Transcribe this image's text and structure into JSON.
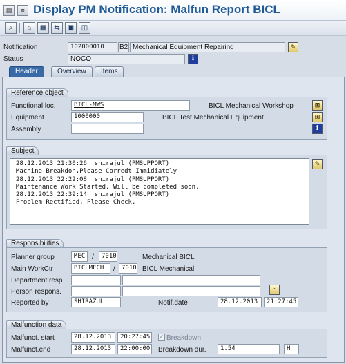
{
  "window": {
    "title": "Display PM Notification: Malfun Report BICL"
  },
  "header": {
    "notification_label": "Notification",
    "notification_number": "102000010",
    "notification_type": "B2",
    "notification_desc": "Mechanical Equipment Repairing",
    "status_label": "Status",
    "status_value": "NOCO"
  },
  "tabs": [
    {
      "label": "Header"
    },
    {
      "label": "Overview"
    },
    {
      "label": "Items"
    }
  ],
  "reference": {
    "title": "Reference object",
    "func_loc_label": "Functional loc.",
    "func_loc_value": "BICL-MWS",
    "func_loc_desc": "BICL Mechanical Workshop",
    "equipment_label": "Equipment",
    "equipment_value": "1000000",
    "equipment_desc": "BICL Test Mechanical Equipment",
    "assembly_label": "Assembly"
  },
  "subject": {
    "title": "Subject",
    "lines": [
      "28.12.2013 21:30:26  shirajul (PMSUPPORT)",
      "Machine Breakdon,Please Corredt Immidiately",
      "28.12.2013 22:22:08  shirajul (PMSUPPORT)",
      "Maintenance Work Started. Will be completed soon.",
      "28.12.2013 22:39:14  shirajul (PMSUPPORT)",
      "Problem Rectified, Please Check."
    ]
  },
  "responsibilities": {
    "title": "Responsibilities",
    "planner_label": "Planner group",
    "planner_code": "MEC",
    "planner_plant": "7010",
    "planner_desc": "Mechanical BICL",
    "workctr_label": "Main WorkCtr",
    "workctr_code": "BICLMECH",
    "workctr_plant": "7010",
    "workctr_desc": "BICL Mechanical",
    "dept_label": "Department resp",
    "person_label": "Person respons.",
    "reported_label": "Reported by",
    "reported_value": "SHIRAZUL",
    "notif_date_label": "Notif.date",
    "notif_date": "28.12.2013",
    "notif_time": "21:27:45",
    "separator": "/"
  },
  "malfunction": {
    "title": "Malfunction data",
    "start_label": "Malfunct. start",
    "start_date": "28.12.2013",
    "start_time": "20:27:45",
    "breakdown_label": "Breakdown",
    "end_label": "Malfunct.end",
    "end_date": "28.12.2013",
    "end_time": "22:00:00",
    "duration_label": "Breakdown dur.",
    "duration_value": "1.54",
    "duration_unit": "H"
  },
  "icons": {
    "info": "i",
    "hierarchy": "⊞",
    "long_text": "✎",
    "overview": "⌂"
  }
}
